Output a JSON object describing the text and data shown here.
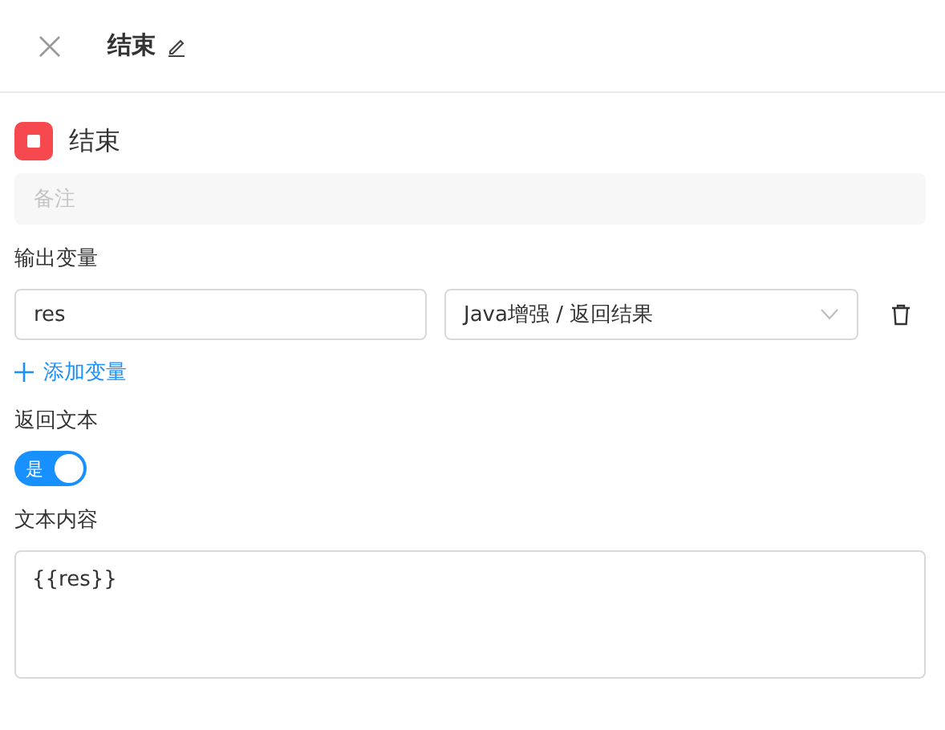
{
  "header": {
    "title": "结束"
  },
  "node": {
    "name": "结束",
    "remark_placeholder": "备注"
  },
  "output_variables": {
    "label": "输出变量",
    "rows": [
      {
        "name": "res",
        "source": "Java增强 / 返回结果"
      }
    ],
    "add_label": "添加变量"
  },
  "return_text": {
    "label": "返回文本",
    "toggle": {
      "on": true,
      "label": "是"
    }
  },
  "text_content": {
    "label": "文本内容",
    "value": "{{res}}"
  }
}
